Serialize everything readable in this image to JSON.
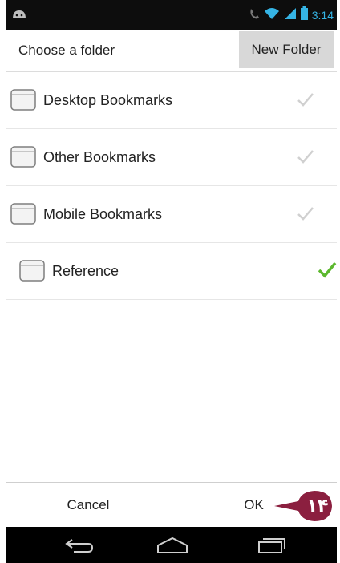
{
  "status_bar": {
    "time": "3:14",
    "icons": [
      "android-notification-icon",
      "wifi-icon",
      "signal-icon",
      "battery-icon"
    ]
  },
  "header": {
    "title": "Choose a folder",
    "new_folder_label": "New Folder"
  },
  "folders": [
    {
      "label": "Desktop Bookmarks",
      "selected": false
    },
    {
      "label": "Other Bookmarks",
      "selected": false
    },
    {
      "label": "Mobile Bookmarks",
      "selected": false
    },
    {
      "label": "Reference",
      "selected": true
    }
  ],
  "footer": {
    "cancel_label": "Cancel",
    "ok_label": "OK"
  },
  "callout": {
    "number": "۱۴",
    "color": "#8b1f3f"
  },
  "nav_bar": {
    "icons": [
      "back-icon",
      "home-icon",
      "recent-apps-icon"
    ]
  },
  "colors": {
    "status_accent": "#35b4e5",
    "check_selected": "#5cb82e",
    "check_unselected": "#d0d0d0"
  }
}
